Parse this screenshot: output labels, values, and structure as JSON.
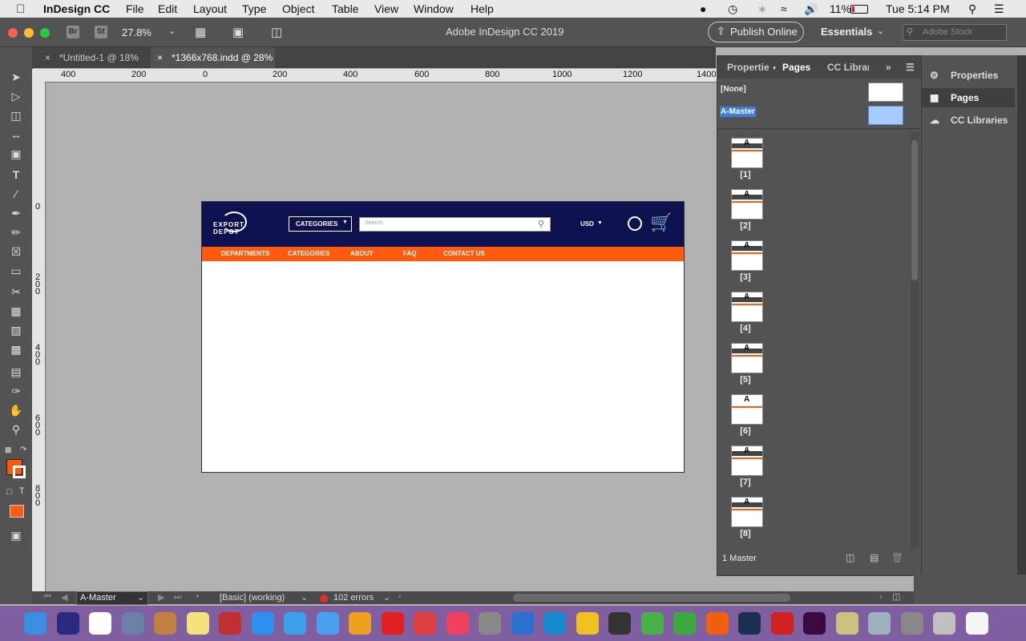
{
  "menubar": {
    "app_name": "InDesign CC",
    "items": [
      "File",
      "Edit",
      "Layout",
      "Type",
      "Object",
      "Table",
      "View",
      "Window",
      "Help"
    ],
    "battery": "11%",
    "clock": "Tue 5:14 PM"
  },
  "app_toolbar": {
    "bridge_label": "Br",
    "stock_label": "St",
    "zoom": "27.8%",
    "window_title": "Adobe InDesign CC 2019",
    "publish_label": "Publish Online",
    "workspace": "Essentials",
    "search_placeholder": "Adobe Stock"
  },
  "tabs": [
    {
      "label": "*Untitled-1 @ 18%",
      "active": false
    },
    {
      "label": "*1366x768.indd @ 28%",
      "active": true
    }
  ],
  "ruler": {
    "h_labels": [
      "400",
      "200",
      "0",
      "200",
      "400",
      "600",
      "800",
      "1000",
      "1200",
      "1400"
    ],
    "v_labels": [
      "0",
      "200",
      "400",
      "600",
      "800"
    ]
  },
  "website_mock": {
    "logo_text": "EXPORT DEPOT",
    "categories_button": "CATEGORIES",
    "search_placeholder": "Search",
    "currency": "USD",
    "nav": [
      "DEPARTMENTS",
      "CATEGORIES",
      "ABOUT",
      "FAQ",
      "CONTACT US"
    ],
    "header_color": "#0d1150",
    "nav_color": "#ff5a0d"
  },
  "pages_panel": {
    "tabs": [
      "Properties",
      "Pages",
      "CC Libraries"
    ],
    "active_tab": "Pages",
    "masters": [
      {
        "label": "[None]"
      },
      {
        "label": "A-Master",
        "selected": true
      }
    ],
    "pages": [
      {
        "label": "[1]",
        "master_prefix": "A"
      },
      {
        "label": "[2]",
        "master_prefix": "A"
      },
      {
        "label": "[3]",
        "master_prefix": "A"
      },
      {
        "label": "[4]",
        "master_prefix": "A"
      },
      {
        "label": "[5]",
        "master_prefix": "A"
      },
      {
        "label": "[6]",
        "master_prefix": "A"
      },
      {
        "label": "[7]",
        "master_prefix": "A"
      },
      {
        "label": "[8]",
        "master_prefix": "A"
      }
    ],
    "footer": "1 Master"
  },
  "side_panels": [
    {
      "label": "Properties",
      "icon": "properties-icon"
    },
    {
      "label": "Pages",
      "icon": "pages-icon",
      "active": true
    },
    {
      "label": "CC Libraries",
      "icon": "cc-libraries-icon"
    }
  ],
  "status_bar": {
    "page_select": "A-Master",
    "preflight_profile": "[Basic] (working)",
    "errors": "102 errors"
  },
  "colors": {
    "fill_swatch": "#ff5a0d",
    "error_dot": "#e03030"
  }
}
